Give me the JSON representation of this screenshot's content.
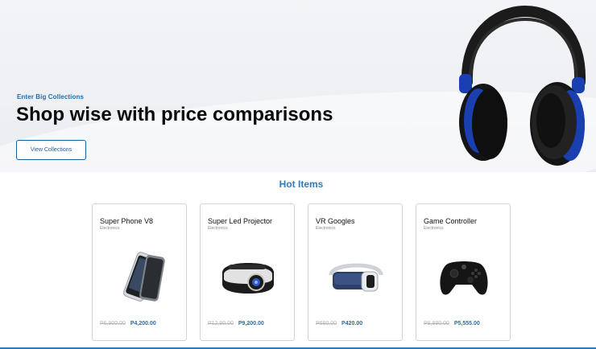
{
  "hero": {
    "kicker": "Enter Big Collections",
    "headline": "Shop wise with price comparisons",
    "cta_label": "View Collections"
  },
  "hot_items": {
    "title": "Hot Items",
    "products": [
      {
        "name": "Super Phone V8",
        "category": "Electronics",
        "old_price": "P6,900.00",
        "price": "P4,200.00"
      },
      {
        "name": "Super Led Projector",
        "category": "Electronics",
        "old_price": "P12,90.00",
        "price": "P9,200.00"
      },
      {
        "name": "VR Googles",
        "category": "Electronics",
        "old_price": "P680.00",
        "price": "P420.00"
      },
      {
        "name": "Game Controller",
        "category": "Electronics",
        "old_price": "P8,890.00",
        "price": "P5,555.00"
      }
    ]
  },
  "colors": {
    "accent": "#2b7bbf",
    "brand_blue": "#1d5e99",
    "headphone_accent": "#1a3fb0"
  },
  "icons": [
    "headphones-image",
    "smartphone-image",
    "projector-image",
    "vr-headset-image",
    "game-controller-image"
  ]
}
